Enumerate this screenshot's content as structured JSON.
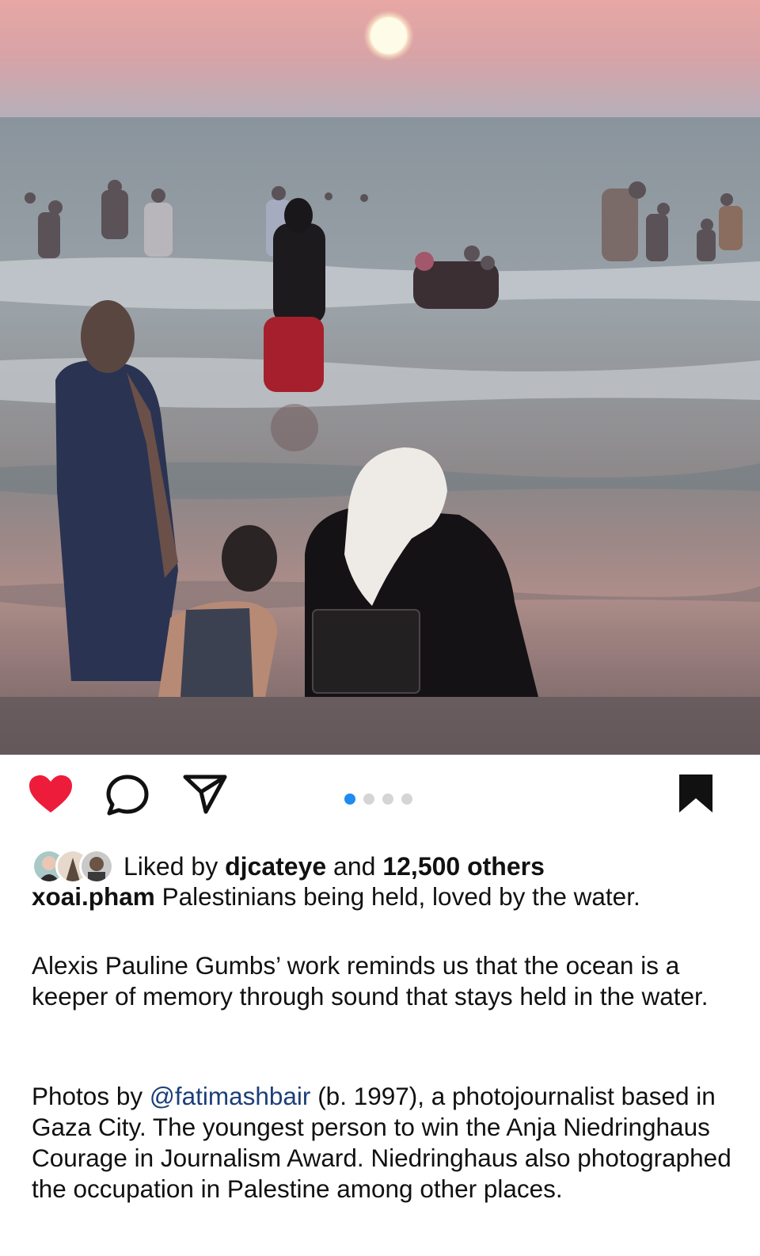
{
  "post": {
    "image_alt": "Beach at sunset with people in the sea",
    "carousel": {
      "count": 4,
      "active": 0
    },
    "liked_by_prefix": "Liked by",
    "liked_by_user": "djcateye",
    "liked_by_and": "and",
    "liked_by_others": "12,500 others",
    "author": "xoai.pham",
    "caption_line1": "Palestinians being held, loved by the water.",
    "paragraph2": "Alexis Pauline Gumbs’ work reminds us that the ocean is a keeper of memory through sound that stays held in the water.",
    "p3_prefix": "Photos by",
    "p3_mention": "@fatimashbair",
    "p3_rest": "(b. 1997), a photojournalist based in Gaza City. The youngest person to win the Anja Niedringhaus Courage in Journalism Award. Niedringhaus also photographed the occupation in Palestine among other places."
  },
  "icons": {
    "like": "heart-filled-icon",
    "comment": "comment-icon",
    "share": "send-icon",
    "save": "bookmark-filled-icon"
  },
  "colors": {
    "like": "#ee1c3b",
    "dot_active": "#1d8cf0",
    "dot_inactive": "#d5d5d5",
    "mention": "#1b3f7a"
  }
}
